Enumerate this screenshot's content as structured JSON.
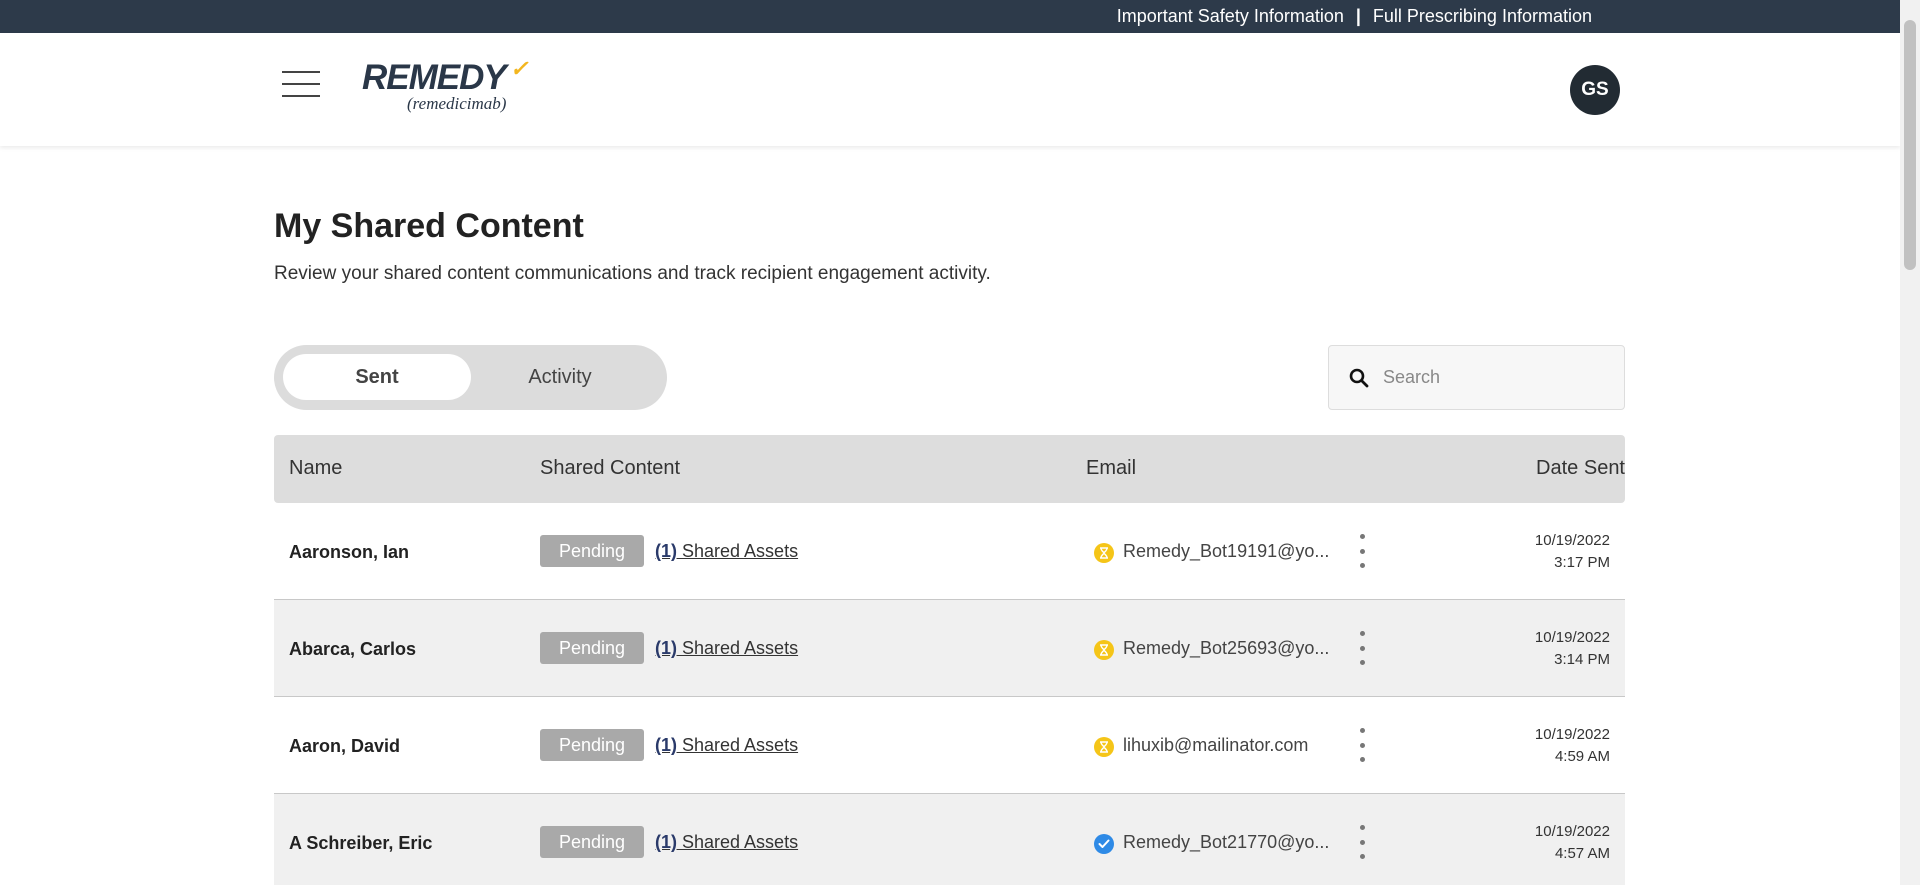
{
  "topbar": {
    "safety_link": "Important Safety Information",
    "separator": "|",
    "prescribing_link": "Full Prescribing Information"
  },
  "header": {
    "logo_main": "REMEDY",
    "logo_sub": "(remedicimab)",
    "avatar_initials": "GS",
    "accent_color": "#f3b61f"
  },
  "main": {
    "title": "My Shared Content",
    "subtitle": "Review your shared content communications and track recipient engagement activity.",
    "tabs": [
      {
        "label": "Sent",
        "active": true
      },
      {
        "label": "Activity",
        "active": false
      }
    ],
    "search": {
      "placeholder": "Search",
      "value": ""
    }
  },
  "table": {
    "columns": [
      "Name",
      "Shared Content",
      "Email",
      "Date Sent"
    ],
    "rows": [
      {
        "name": "Aaronson, Ian",
        "status": "Pending",
        "count": "(1)",
        "assets": " Shared Assets",
        "email_status": "pending",
        "email": "Remedy_Bot19191@yo...",
        "date": "10/19/2022",
        "time": "3:17 PM"
      },
      {
        "name": "Abarca, Carlos",
        "status": "Pending",
        "count": "(1)",
        "assets": " Shared Assets",
        "email_status": "pending",
        "email": "Remedy_Bot25693@yo...",
        "date": "10/19/2022",
        "time": "3:14 PM"
      },
      {
        "name": "Aaron, David",
        "status": "Pending",
        "count": "(1)",
        "assets": " Shared Assets",
        "email_status": "pending",
        "email": "lihuxib@mailinator.com",
        "date": "10/19/2022",
        "time": "4:59 AM"
      },
      {
        "name": "A Schreiber, Eric",
        "status": "Pending",
        "count": "(1)",
        "assets": " Shared Assets",
        "email_status": "delivered",
        "email": "Remedy_Bot21770@yo...",
        "date": "10/19/2022",
        "time": "4:57 AM"
      }
    ]
  },
  "colors": {
    "topbar_bg": "#2d3a4a",
    "pending_icon": "#f5c518",
    "delivered_icon": "#2e8ae6",
    "badge_bg": "#a9a9a9"
  }
}
